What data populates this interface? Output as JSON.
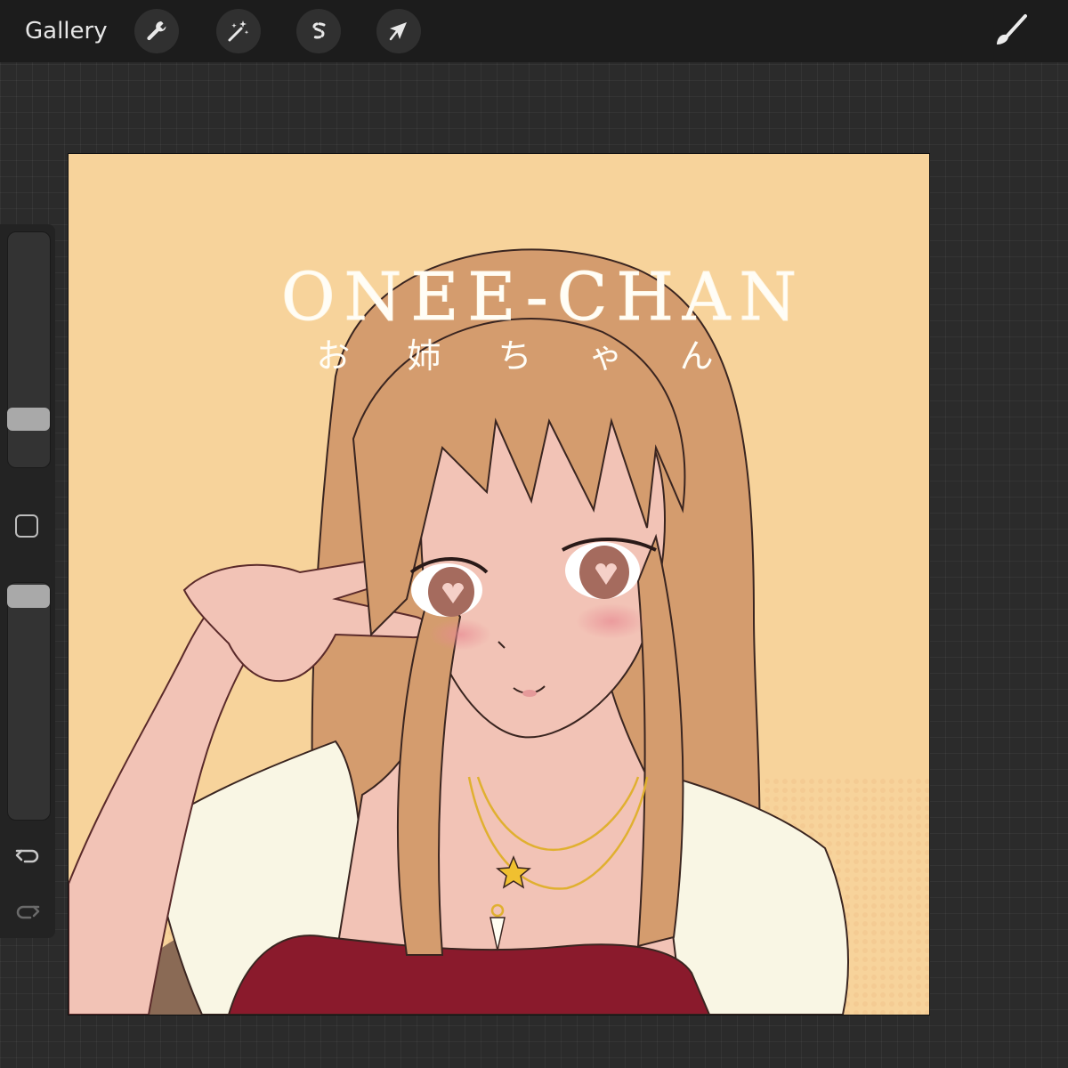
{
  "toolbar": {
    "gallery_label": "Gallery",
    "tools": [
      {
        "name": "actions",
        "icon": "wrench-icon"
      },
      {
        "name": "adjustments",
        "icon": "magic-wand-icon"
      },
      {
        "name": "selection",
        "icon": "selection-s-icon"
      },
      {
        "name": "transform",
        "icon": "arrow-cursor-icon"
      }
    ],
    "brush_icon": "paintbrush-icon"
  },
  "sidebar": {
    "brush_size_level": 0.76,
    "opacity_level": 0.04,
    "modify_icon": "square-icon",
    "undo_icon": "undo-arrow-icon",
    "redo_icon": "redo-arrow-icon"
  },
  "canvas": {
    "title_en": "ONEE-CHAN",
    "title_jp": "お 姉 ち ゃ ん",
    "colors": {
      "background": "#f7d39b",
      "hair": "#d49c6e",
      "skin": "#f2c3b6",
      "jacket": "#f9f6e4",
      "dress": "#8a1a2c",
      "necklace": "#e0b030"
    }
  },
  "theme": {
    "topbar_bg": "#1c1c1c",
    "app_bg": "#2b2b2b",
    "text": "#e6e6e6"
  }
}
